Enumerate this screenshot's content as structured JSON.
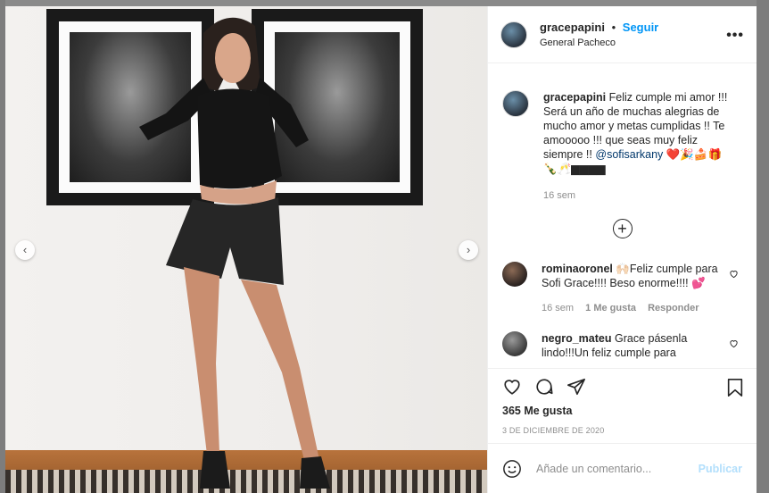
{
  "post": {
    "username": "gracepapini",
    "follow_label": "Seguir",
    "separator": "•",
    "location": "General Pacheco",
    "more_label": "•••"
  },
  "caption": {
    "username": "gracepapini",
    "text": "Feliz cumple mi amor !!! Será un año de muchas alegrias de mucho amor y metas cumplidas !! Te amooooo !!! que seas muy feliz siempre !!",
    "mention": "@sofisarkany",
    "emoji": "❤️🎉🍰🎁🍾🥂▆▆▆▆",
    "time": "16 sem"
  },
  "load_more_label": "+",
  "comments": [
    {
      "username": "rominaoronel",
      "text": "🙌🏻Feliz cumple para Sofi Grace!!!! Beso enorme!!!! 💕",
      "time": "16 sem",
      "likes": "1 Me gusta",
      "reply": "Responder"
    },
    {
      "username": "negro_mateu",
      "text": "Grace pásenla lindo!!!Un feliz cumple para"
    }
  ],
  "likes_text": "365 Me gusta",
  "date_text": "3 DE DICIEMBRE DE 2020",
  "comment_box": {
    "placeholder": "Añade un comentario...",
    "post_label": "Publicar"
  },
  "carousel": {
    "prev": "‹",
    "next": "›"
  },
  "colors": {
    "accent": "#0095f6",
    "text": "#262626",
    "muted": "#8e8e8e",
    "post_disabled": "#b2dffc"
  }
}
